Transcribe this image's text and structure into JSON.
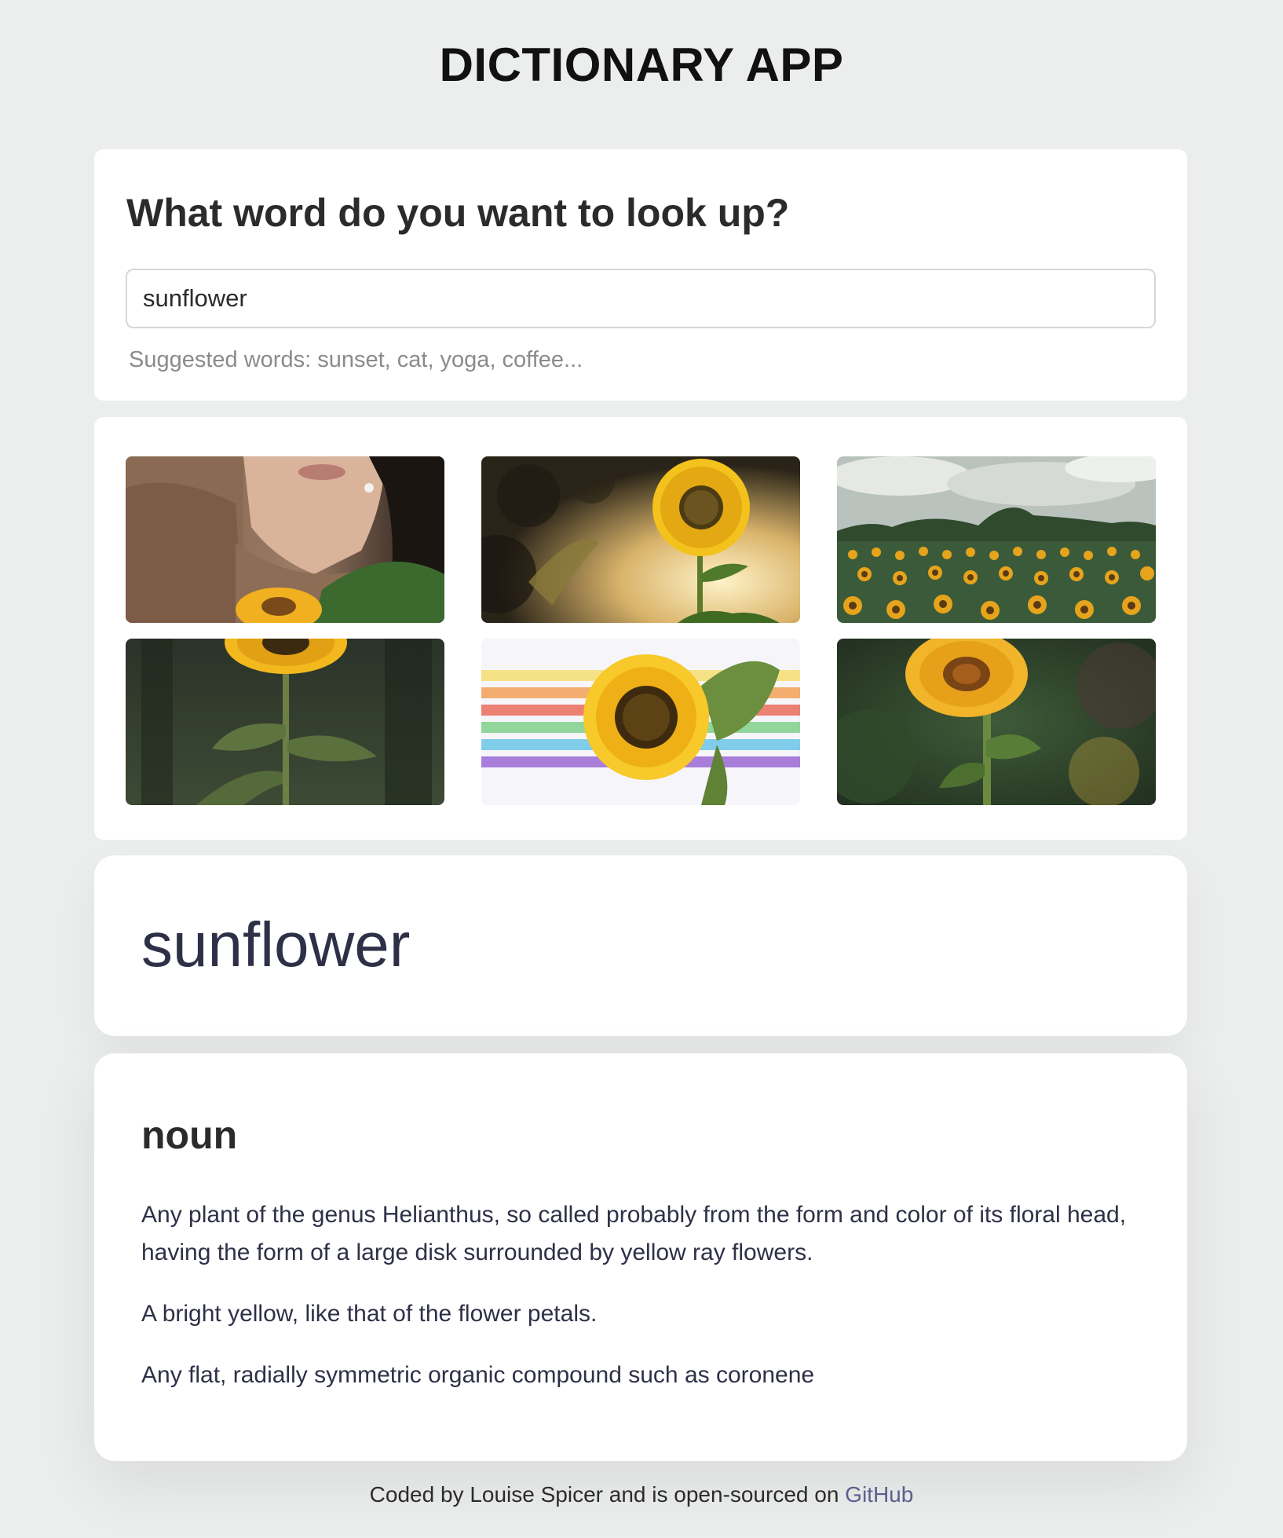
{
  "app": {
    "title": "DICTIONARY APP"
  },
  "search": {
    "heading": "What word do you want to look up?",
    "value": "sunflower",
    "suggestions": "Suggested words: sunset, cat, yoga, coffee..."
  },
  "photos": [
    {
      "name": "woman-with-sunflower-photo"
    },
    {
      "name": "sunflower-sunset-photo"
    },
    {
      "name": "sunflower-field-photo"
    },
    {
      "name": "tall-sunflower-photo"
    },
    {
      "name": "sunflower-rainbow-photo"
    },
    {
      "name": "sunflower-closeup-photo"
    }
  ],
  "result": {
    "word": "sunflower",
    "part_of_speech": "noun",
    "definitions": [
      "Any plant of the genus Helianthus, so called probably from the form and color of its floral head, having the form of a large disk surrounded by yellow ray flowers.",
      "A bright yellow, like that of the flower petals.",
      "Any flat, radially symmetric organic compound such as coronene"
    ]
  },
  "footer": {
    "text": "Coded by Louise Spicer and is open-sourced on ",
    "link_label": "GitHub"
  },
  "colors": {
    "background": "#eceeed",
    "card": "#ffffff",
    "word_text": "#2e3047",
    "link": "#5a5f8f",
    "muted": "#8b8b8b"
  }
}
